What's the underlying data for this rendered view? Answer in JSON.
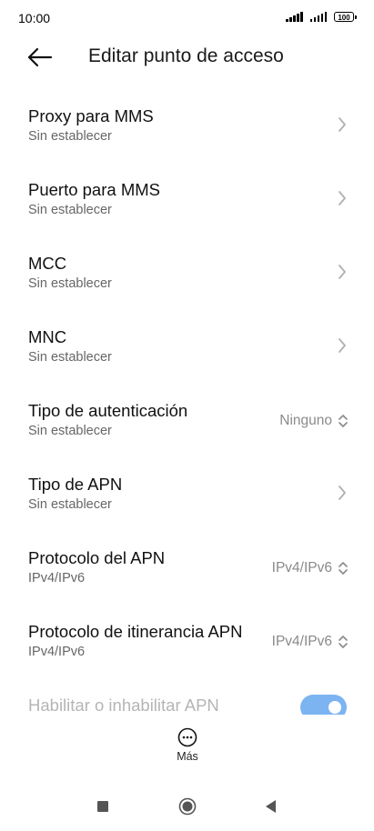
{
  "status": {
    "time": "10:00",
    "battery": "100"
  },
  "header": {
    "back_icon": "arrow-left-icon",
    "title": "Editar punto de acceso"
  },
  "rows": [
    {
      "title": "Proxy para MMS",
      "subtitle": "Sin establecer",
      "control": "chevron-right-icon"
    },
    {
      "title": "Puerto para MMS",
      "subtitle": "Sin establecer",
      "control": "chevron-right-icon"
    },
    {
      "title": "MCC",
      "subtitle": "Sin establecer",
      "control": "chevron-right-icon"
    },
    {
      "title": "MNC",
      "subtitle": "Sin establecer",
      "control": "chevron-right-icon"
    },
    {
      "title": "Tipo de autenticación",
      "subtitle": "Sin establecer",
      "value": "Ninguno",
      "control": "updown-icon"
    },
    {
      "title": "Tipo de APN",
      "subtitle": "Sin establecer",
      "control": "chevron-right-icon"
    },
    {
      "title": "Protocolo del APN",
      "subtitle": "IPv4/IPv6",
      "value": "IPv4/IPv6",
      "control": "updown-icon"
    },
    {
      "title": "Protocolo de itinerancia APN",
      "subtitle": "IPv4/IPv6",
      "value": "IPv4/IPv6",
      "control": "updown-icon"
    },
    {
      "title": "Habilitar o inhabilitar APN",
      "control": "toggle",
      "enabled": true
    }
  ],
  "bottom_action": {
    "icon": "more-horizontal-icon",
    "label": "Más"
  },
  "colors": {
    "accent": "#7cb4f2",
    "subtitle": "#666666",
    "value": "#8a8a8a"
  }
}
